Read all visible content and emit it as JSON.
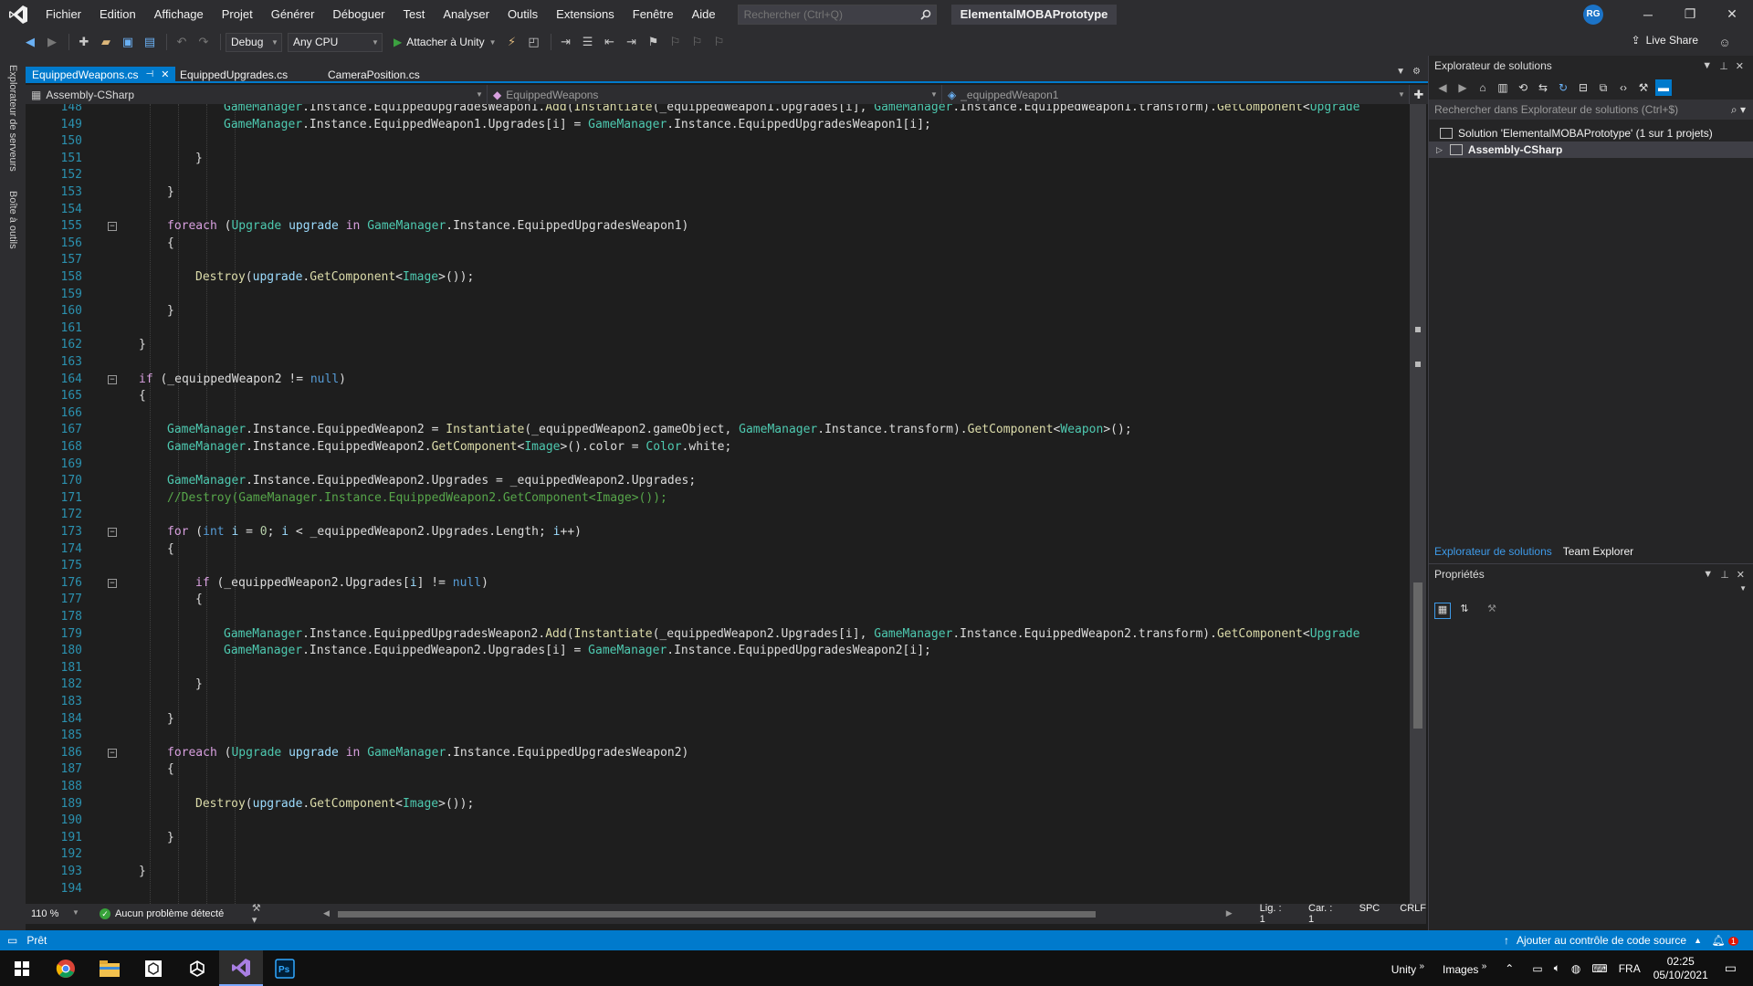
{
  "menu": {
    "items": [
      "Fichier",
      "Edition",
      "Affichage",
      "Projet",
      "Générer",
      "Déboguer",
      "Test",
      "Analyser",
      "Outils",
      "Extensions",
      "Fenêtre",
      "Aide"
    ],
    "search_placeholder": "Rechercher (Ctrl+Q)",
    "solution_name": "ElementalMOBAPrototype",
    "user_initials": "RG"
  },
  "toolbar": {
    "config": "Debug",
    "platform": "Any CPU",
    "attach_label": "Attacher à Unity",
    "live_share": "Live Share"
  },
  "left_rail": {
    "tabs": [
      "Explorateur de serveurs",
      "Boîte à outils"
    ]
  },
  "tabs": [
    {
      "label": "EquippedWeapons.cs",
      "active": true
    },
    {
      "label": "EquippedUpgrades.cs",
      "active": false
    },
    {
      "label": "CameraPosition.cs",
      "active": false
    }
  ],
  "nav": {
    "project": "Assembly-CSharp",
    "type": "EquippedWeapons",
    "member": "_equippedWeapon1"
  },
  "code_lines": [
    {
      "n": "148",
      "fold": false,
      "indent": 7,
      "segs": [
        [
          "type",
          "GameManager"
        ],
        [
          "plain",
          ".Instance.EquippedUpgradesWeapon1."
        ],
        [
          "meth",
          "Add"
        ],
        [
          "plain",
          "("
        ],
        [
          "meth",
          "Instantiate"
        ],
        [
          "plain",
          "(_equippedWeapon1.Upgrades[i], "
        ],
        [
          "type",
          "GameManager"
        ],
        [
          "plain",
          ".Instance.EquippedWeapon1.transform)."
        ],
        [
          "meth",
          "GetComponent"
        ],
        [
          "plain",
          "<"
        ],
        [
          "type",
          "Upgrade"
        ]
      ]
    },
    {
      "n": "149",
      "fold": false,
      "indent": 7,
      "segs": [
        [
          "type",
          "GameManager"
        ],
        [
          "plain",
          ".Instance.EquippedWeapon1.Upgrades[i] = "
        ],
        [
          "type",
          "GameManager"
        ],
        [
          "plain",
          ".Instance.EquippedUpgradesWeapon1[i];"
        ]
      ]
    },
    {
      "n": "150",
      "fold": false,
      "indent": 0,
      "segs": []
    },
    {
      "n": "151",
      "fold": false,
      "indent": 6,
      "segs": [
        [
          "plain",
          "}"
        ]
      ]
    },
    {
      "n": "152",
      "fold": false,
      "indent": 0,
      "segs": []
    },
    {
      "n": "153",
      "fold": false,
      "indent": 5,
      "segs": [
        [
          "plain",
          "}"
        ]
      ]
    },
    {
      "n": "154",
      "fold": false,
      "indent": 0,
      "segs": []
    },
    {
      "n": "155",
      "fold": true,
      "indent": 5,
      "segs": [
        [
          "ctl",
          "foreach"
        ],
        [
          "plain",
          " ("
        ],
        [
          "type",
          "Upgrade"
        ],
        [
          "plain",
          " "
        ],
        [
          "var",
          "upgrade"
        ],
        [
          "plain",
          " "
        ],
        [
          "ctl",
          "in"
        ],
        [
          "plain",
          " "
        ],
        [
          "type",
          "GameManager"
        ],
        [
          "plain",
          ".Instance.EquippedUpgradesWeapon1)"
        ]
      ]
    },
    {
      "n": "156",
      "fold": false,
      "indent": 5,
      "segs": [
        [
          "plain",
          "{"
        ]
      ]
    },
    {
      "n": "157",
      "fold": false,
      "indent": 0,
      "segs": []
    },
    {
      "n": "158",
      "fold": false,
      "indent": 6,
      "segs": [
        [
          "meth",
          "Destroy"
        ],
        [
          "plain",
          "("
        ],
        [
          "var",
          "upgrade"
        ],
        [
          "plain",
          "."
        ],
        [
          "meth",
          "GetComponent"
        ],
        [
          "plain",
          "<"
        ],
        [
          "type",
          "Image"
        ],
        [
          "plain",
          ">());"
        ]
      ]
    },
    {
      "n": "159",
      "fold": false,
      "indent": 0,
      "segs": []
    },
    {
      "n": "160",
      "fold": false,
      "indent": 5,
      "segs": [
        [
          "plain",
          "}"
        ]
      ]
    },
    {
      "n": "161",
      "fold": false,
      "indent": 0,
      "segs": []
    },
    {
      "n": "162",
      "fold": false,
      "indent": 4,
      "segs": [
        [
          "plain",
          "}"
        ]
      ]
    },
    {
      "n": "163",
      "fold": false,
      "indent": 0,
      "segs": []
    },
    {
      "n": "164",
      "fold": true,
      "indent": 4,
      "segs": [
        [
          "ctl",
          "if"
        ],
        [
          "plain",
          " (_equippedWeapon2 != "
        ],
        [
          "kw",
          "null"
        ],
        [
          "plain",
          ")"
        ]
      ]
    },
    {
      "n": "165",
      "fold": false,
      "indent": 4,
      "segs": [
        [
          "plain",
          "{"
        ]
      ]
    },
    {
      "n": "166",
      "fold": false,
      "indent": 0,
      "segs": []
    },
    {
      "n": "167",
      "fold": false,
      "indent": 5,
      "segs": [
        [
          "type",
          "GameManager"
        ],
        [
          "plain",
          ".Instance.EquippedWeapon2 = "
        ],
        [
          "meth",
          "Instantiate"
        ],
        [
          "plain",
          "(_equippedWeapon2.gameObject, "
        ],
        [
          "type",
          "GameManager"
        ],
        [
          "plain",
          ".Instance.transform)."
        ],
        [
          "meth",
          "GetComponent"
        ],
        [
          "plain",
          "<"
        ],
        [
          "type",
          "Weapon"
        ],
        [
          "plain",
          ">();"
        ]
      ]
    },
    {
      "n": "168",
      "fold": false,
      "indent": 5,
      "segs": [
        [
          "type",
          "GameManager"
        ],
        [
          "plain",
          ".Instance.EquippedWeapon2."
        ],
        [
          "meth",
          "GetComponent"
        ],
        [
          "plain",
          "<"
        ],
        [
          "type",
          "Image"
        ],
        [
          "plain",
          ">().color = "
        ],
        [
          "type",
          "Color"
        ],
        [
          "plain",
          ".white;"
        ]
      ]
    },
    {
      "n": "169",
      "fold": false,
      "indent": 0,
      "segs": []
    },
    {
      "n": "170",
      "fold": false,
      "indent": 5,
      "segs": [
        [
          "type",
          "GameManager"
        ],
        [
          "plain",
          ".Instance.EquippedWeapon2.Upgrades = _equippedWeapon2.Upgrades;"
        ]
      ]
    },
    {
      "n": "171",
      "fold": false,
      "indent": 5,
      "segs": [
        [
          "com",
          "//Destroy(GameManager.Instance.EquippedWeapon2.GetComponent<Image>());"
        ]
      ]
    },
    {
      "n": "172",
      "fold": false,
      "indent": 0,
      "segs": []
    },
    {
      "n": "173",
      "fold": true,
      "indent": 5,
      "segs": [
        [
          "ctl",
          "for"
        ],
        [
          "plain",
          " ("
        ],
        [
          "kw",
          "int"
        ],
        [
          "plain",
          " "
        ],
        [
          "var",
          "i"
        ],
        [
          "plain",
          " = "
        ],
        [
          "num",
          "0"
        ],
        [
          "plain",
          "; "
        ],
        [
          "var",
          "i"
        ],
        [
          "plain",
          " < _equippedWeapon2.Upgrades.Length; "
        ],
        [
          "var",
          "i"
        ],
        [
          "plain",
          "++)"
        ]
      ]
    },
    {
      "n": "174",
      "fold": false,
      "indent": 5,
      "segs": [
        [
          "plain",
          "{"
        ]
      ]
    },
    {
      "n": "175",
      "fold": false,
      "indent": 0,
      "segs": []
    },
    {
      "n": "176",
      "fold": true,
      "indent": 6,
      "segs": [
        [
          "ctl",
          "if"
        ],
        [
          "plain",
          " (_equippedWeapon2.Upgrades["
        ],
        [
          "var",
          "i"
        ],
        [
          "plain",
          "] != "
        ],
        [
          "kw",
          "null"
        ],
        [
          "plain",
          ")"
        ]
      ]
    },
    {
      "n": "177",
      "fold": false,
      "indent": 6,
      "segs": [
        [
          "plain",
          "{"
        ]
      ]
    },
    {
      "n": "178",
      "fold": false,
      "indent": 0,
      "segs": []
    },
    {
      "n": "179",
      "fold": false,
      "indent": 7,
      "segs": [
        [
          "type",
          "GameManager"
        ],
        [
          "plain",
          ".Instance.EquippedUpgradesWeapon2."
        ],
        [
          "meth",
          "Add"
        ],
        [
          "plain",
          "("
        ],
        [
          "meth",
          "Instantiate"
        ],
        [
          "plain",
          "(_equippedWeapon2.Upgrades[i], "
        ],
        [
          "type",
          "GameManager"
        ],
        [
          "plain",
          ".Instance.EquippedWeapon2.transform)."
        ],
        [
          "meth",
          "GetComponent"
        ],
        [
          "plain",
          "<"
        ],
        [
          "type",
          "Upgrade"
        ]
      ]
    },
    {
      "n": "180",
      "fold": false,
      "indent": 7,
      "segs": [
        [
          "type",
          "GameManager"
        ],
        [
          "plain",
          ".Instance.EquippedWeapon2.Upgrades[i] = "
        ],
        [
          "type",
          "GameManager"
        ],
        [
          "plain",
          ".Instance.EquippedUpgradesWeapon2[i];"
        ]
      ]
    },
    {
      "n": "181",
      "fold": false,
      "indent": 0,
      "segs": []
    },
    {
      "n": "182",
      "fold": false,
      "indent": 6,
      "segs": [
        [
          "plain",
          "}"
        ]
      ]
    },
    {
      "n": "183",
      "fold": false,
      "indent": 0,
      "segs": []
    },
    {
      "n": "184",
      "fold": false,
      "indent": 5,
      "segs": [
        [
          "plain",
          "}"
        ]
      ]
    },
    {
      "n": "185",
      "fold": false,
      "indent": 0,
      "segs": []
    },
    {
      "n": "186",
      "fold": true,
      "indent": 5,
      "segs": [
        [
          "ctl",
          "foreach"
        ],
        [
          "plain",
          " ("
        ],
        [
          "type",
          "Upgrade"
        ],
        [
          "plain",
          " "
        ],
        [
          "var",
          "upgrade"
        ],
        [
          "plain",
          " "
        ],
        [
          "ctl",
          "in"
        ],
        [
          "plain",
          " "
        ],
        [
          "type",
          "GameManager"
        ],
        [
          "plain",
          ".Instance.EquippedUpgradesWeapon2)"
        ]
      ]
    },
    {
      "n": "187",
      "fold": false,
      "indent": 5,
      "segs": [
        [
          "plain",
          "{"
        ]
      ]
    },
    {
      "n": "188",
      "fold": false,
      "indent": 0,
      "segs": []
    },
    {
      "n": "189",
      "fold": false,
      "indent": 6,
      "segs": [
        [
          "meth",
          "Destroy"
        ],
        [
          "plain",
          "("
        ],
        [
          "var",
          "upgrade"
        ],
        [
          "plain",
          "."
        ],
        [
          "meth",
          "GetComponent"
        ],
        [
          "plain",
          "<"
        ],
        [
          "type",
          "Image"
        ],
        [
          "plain",
          ">());"
        ]
      ]
    },
    {
      "n": "190",
      "fold": false,
      "indent": 0,
      "segs": []
    },
    {
      "n": "191",
      "fold": false,
      "indent": 5,
      "segs": [
        [
          "plain",
          "}"
        ]
      ]
    },
    {
      "n": "192",
      "fold": false,
      "indent": 0,
      "segs": []
    },
    {
      "n": "193",
      "fold": false,
      "indent": 4,
      "segs": [
        [
          "plain",
          "}"
        ]
      ]
    },
    {
      "n": "194",
      "fold": false,
      "indent": 0,
      "segs": []
    }
  ],
  "editor_status": {
    "zoom": "110 %",
    "issues": "Aucun problème détecté",
    "line": "Lig. : 1",
    "col": "Car. : 1",
    "spc": "SPC",
    "eol": "CRLF"
  },
  "solution_explorer": {
    "title": "Explorateur de solutions",
    "search_placeholder": "Rechercher dans Explorateur de solutions (Ctrl+$)",
    "solution_label": "Solution 'ElementalMOBAPrototype' (1 sur 1 projets)",
    "project_label": "Assembly-CSharp",
    "tab_active": "Explorateur de solutions",
    "tab_other": "Team Explorer"
  },
  "properties": {
    "title": "Propriétés"
  },
  "statusbar": {
    "ready": "Prêt",
    "source_control": "Ajouter au contrôle de code source",
    "notif_count": "1"
  },
  "taskbar": {
    "unity": "Unity",
    "images": "Images",
    "lang": "FRA",
    "time": "02:25",
    "date": "05/10/2021"
  },
  "colors": {
    "accent": "#007acc",
    "bg": "#1e1e1e",
    "chrome": "#2d2d30"
  }
}
